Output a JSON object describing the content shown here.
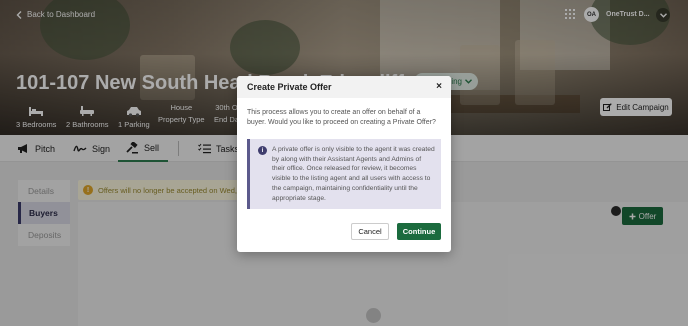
{
  "header": {
    "back_label": "Back to Dashboard",
    "avatar_initials": "OA",
    "org_name": "OneTrust D...",
    "property_title": "101-107 New South Head Road, Edgecliff",
    "status": "Selling",
    "edit_campaign": "Edit Campaign"
  },
  "features": [
    {
      "value": "",
      "label": "3 Bedrooms",
      "icon": "bed-icon"
    },
    {
      "value": "",
      "label": "2 Bathrooms",
      "icon": "bath-icon"
    },
    {
      "value": "",
      "label": "1 Parking",
      "icon": "car-icon"
    },
    {
      "value": "House",
      "label": "Property Type"
    },
    {
      "value": "30th O",
      "label": "End Da"
    }
  ],
  "tabs": [
    {
      "label": "Pitch",
      "icon": "megaphone-icon"
    },
    {
      "label": "Sign",
      "icon": "signature-icon"
    },
    {
      "label": "Sell",
      "icon": "gavel-icon"
    },
    {
      "label": "Tasks",
      "icon": "checklist-icon"
    }
  ],
  "sidenav": [
    "Details",
    "Buyers",
    "Deposits"
  ],
  "notice": "Offers will no longer be accepted on Wed, 30",
  "offer_button": "Offer",
  "modal": {
    "title": "Create Private Offer",
    "close": "×",
    "intro": "This process allows you to create an offer on behalf of a buyer. Would you like to proceed on creating a Private Offer?",
    "info": "A private offer is only visible to the agent it was created by along with their Assistant Agents and Admins of their office. Once released for review, it becomes visible to the listing agent and all users with access to the campaign, maintaining confidentiality until the appropriate stage.",
    "cancel": "Cancel",
    "continue": "Continue"
  },
  "colors": {
    "accent_green": "#1b6b3e",
    "nav_active": "#3b3b6b",
    "info_bg": "#e3e1ee",
    "notice_bg": "#fbf7df"
  }
}
